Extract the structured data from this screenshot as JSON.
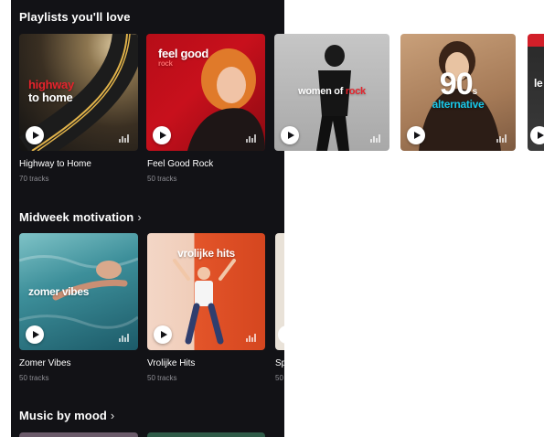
{
  "sections": [
    {
      "title": "Playlists you'll love",
      "chevron": "",
      "cards": [
        {
          "cover_line1": "highway",
          "cover_line2": "to home",
          "title": "Highway to Home",
          "subtitle": "70 tracks"
        },
        {
          "cover_line1": "feel good",
          "cover_line2": "rock",
          "title": "Feel Good Rock",
          "subtitle": "50 tracks"
        },
        {
          "cover_line1": "women of",
          "cover_line2": "rock",
          "title": "",
          "subtitle": ""
        },
        {
          "cover_line1": "90",
          "cover_line1_sup": "s",
          "cover_line2": "alternative",
          "title": "",
          "subtitle": ""
        },
        {
          "cover_line1": "le",
          "title": "",
          "subtitle": ""
        }
      ]
    },
    {
      "title": "Midweek motivation",
      "chevron": "›",
      "cards": [
        {
          "cover_line1": "zomer vibes",
          "title": "Zomer Vibes",
          "subtitle": "50 tracks"
        },
        {
          "cover_line1": "vrolijke hits",
          "title": "Vrolijke Hits",
          "subtitle": "50 tracks"
        },
        {
          "title": "Sp",
          "subtitle": "50"
        }
      ]
    },
    {
      "title": "Music by mood",
      "chevron": "›"
    }
  ],
  "colors": {
    "panel_background": "#121216",
    "highway_red": "#e5232c",
    "feel_good_red": "#c8101c",
    "alternative_cyan": "#18c7e8",
    "muted_text": "#8d8d93"
  },
  "icons": {
    "play": "play-icon",
    "equalizer": "equalizer-icon",
    "chevron": "chevron-right-icon"
  }
}
